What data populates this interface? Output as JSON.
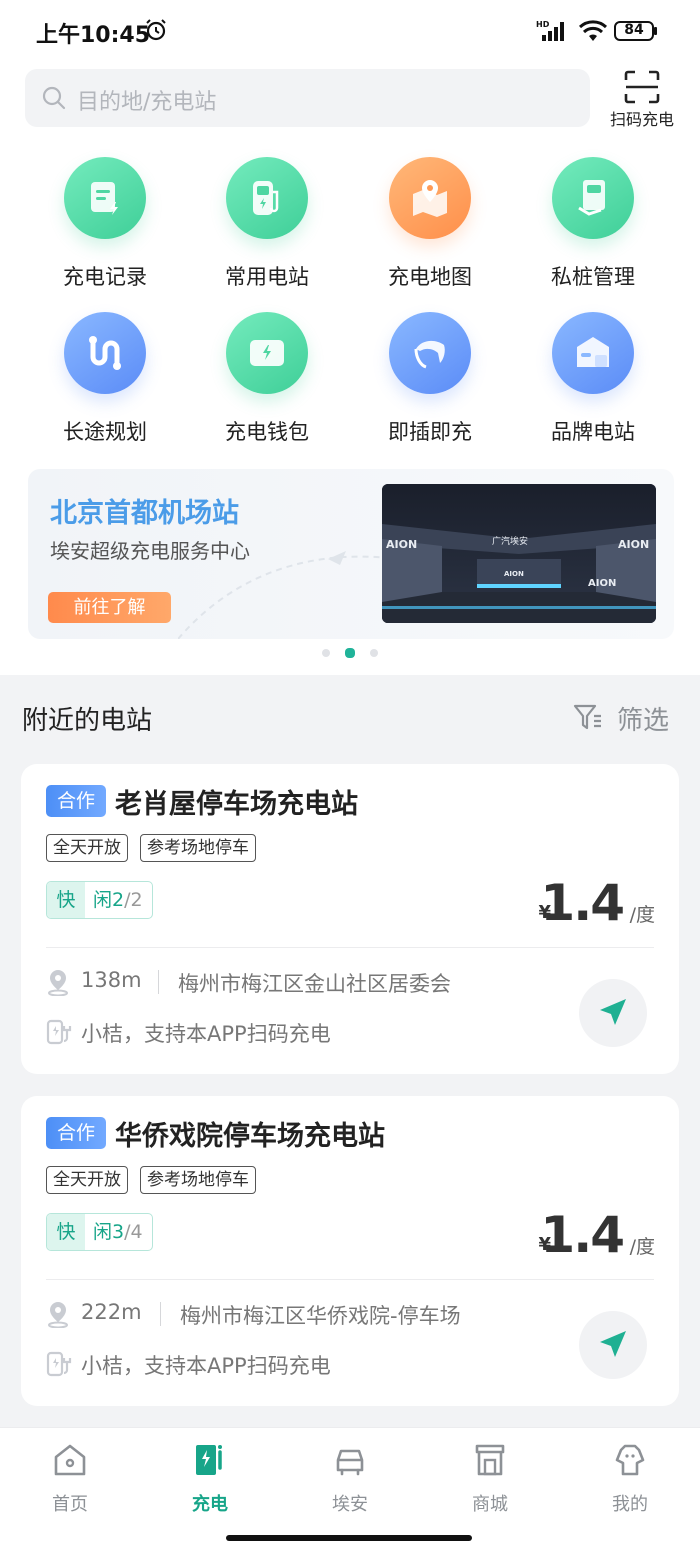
{
  "status_bar": {
    "time": "上午10:45",
    "battery": "84"
  },
  "search": {
    "placeholder": "目的地/充电站",
    "scan_label": "扫码充电"
  },
  "quick_actions": [
    {
      "label": "充电记录",
      "icon": "charge-record-icon",
      "color": "green"
    },
    {
      "label": "常用电站",
      "icon": "charging-pile-icon",
      "color": "green"
    },
    {
      "label": "充电地图",
      "icon": "map-pin-icon",
      "color": "orange"
    },
    {
      "label": "私桩管理",
      "icon": "wall-charger-icon",
      "color": "green"
    },
    {
      "label": "长途规划",
      "icon": "route-icon",
      "color": "blue"
    },
    {
      "label": "充电钱包",
      "icon": "wallet-icon",
      "color": "green"
    },
    {
      "label": "即插即充",
      "icon": "plug-icon",
      "color": "blue"
    },
    {
      "label": "品牌电站",
      "icon": "brand-station-icon",
      "color": "blue"
    }
  ],
  "banner": {
    "title": "北京首都机场站",
    "subtitle": "埃安超级充电服务中心",
    "cta": "前往了解",
    "image_brand_text": "AION",
    "image_sign_text": "广汽埃安",
    "page_index": 2,
    "page_count": 3
  },
  "nearby": {
    "title": "附近的电站",
    "filter_label": "筛选",
    "stations": [
      {
        "badge": "合作",
        "name": "老肖屋停车场充电站",
        "tags": [
          "全天开放",
          "参考场地停车"
        ],
        "fast_label": "快",
        "idle_prefix": "闲",
        "idle_count": "2",
        "idle_total": "/2",
        "currency": "¥",
        "price": "1.4",
        "unit": "/度",
        "distance": "138m",
        "address": "梅州市梅江区金山社区居委会",
        "operator_note": "小桔，支持本APP扫码充电"
      },
      {
        "badge": "合作",
        "name": "华侨戏院停车场充电站",
        "tags": [
          "全天开放",
          "参考场地停车"
        ],
        "fast_label": "快",
        "idle_prefix": "闲",
        "idle_count": "3",
        "idle_total": "/4",
        "currency": "¥",
        "price": "1.4",
        "unit": "/度",
        "distance": "222m",
        "address": "梅州市梅江区华侨戏院-停车场",
        "operator_note": "小桔，支持本APP扫码充电"
      }
    ]
  },
  "bottom_nav": [
    {
      "label": "首页",
      "icon": "home-icon",
      "active": false
    },
    {
      "label": "充电",
      "icon": "charge-icon",
      "active": true
    },
    {
      "label": "埃安",
      "icon": "car-icon",
      "active": false
    },
    {
      "label": "商城",
      "icon": "store-icon",
      "active": false
    },
    {
      "label": "我的",
      "icon": "profile-icon",
      "active": false
    }
  ],
  "colors": {
    "accent": "#17a589",
    "banner_title": "#4b9ce8",
    "cta": "#ff8a4c",
    "badge": "#4d8ff6"
  }
}
